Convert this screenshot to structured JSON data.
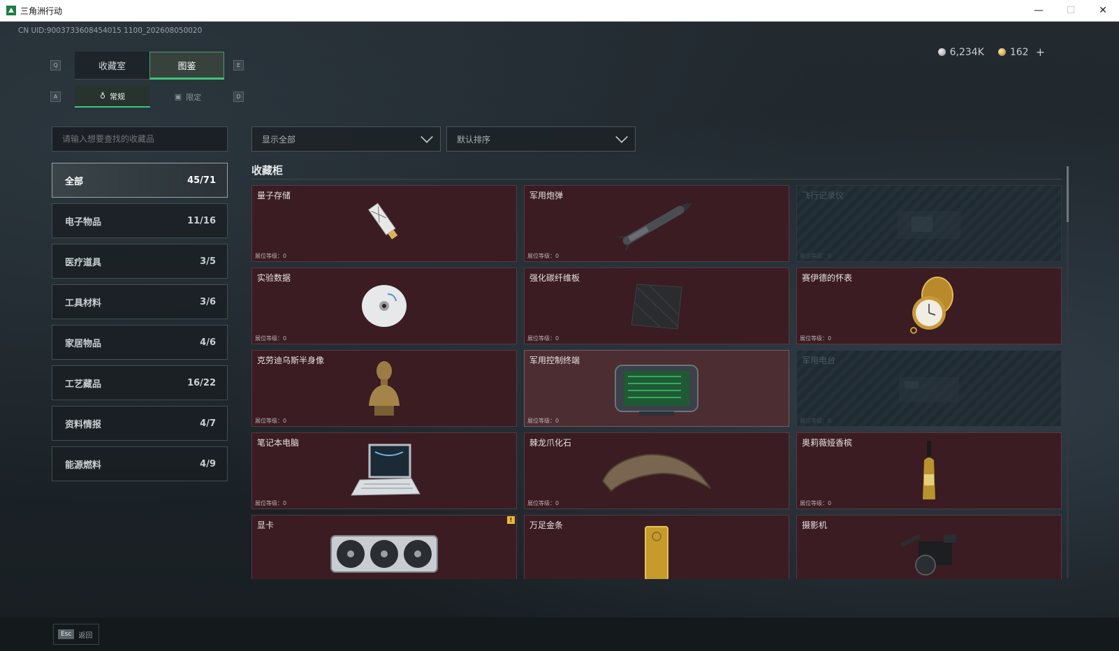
{
  "window": {
    "title": "三角洲行动",
    "min": "—",
    "max": "☐",
    "close": "✕"
  },
  "uid": "CN UID:9003733608454015 1100_202608050020",
  "currency": {
    "silver": "6,234K",
    "gold": "162",
    "plus": "+"
  },
  "keys": {
    "q": "Q",
    "e": "E",
    "a": "A",
    "d": "D"
  },
  "tabs": [
    {
      "label": "收藏室"
    },
    {
      "label": "图鉴"
    }
  ],
  "subtabs": [
    {
      "label": "常规"
    },
    {
      "label": "限定"
    }
  ],
  "search": {
    "placeholder": "请输入想要查找的收藏品"
  },
  "filter": {
    "label": "显示全部"
  },
  "sort": {
    "label": "默认排序"
  },
  "categories": [
    {
      "name": "全部",
      "count": "45/71"
    },
    {
      "name": "电子物品",
      "count": "11/16"
    },
    {
      "name": "医疗道具",
      "count": "3/5"
    },
    {
      "name": "工具材料",
      "count": "3/6"
    },
    {
      "name": "家居物品",
      "count": "4/6"
    },
    {
      "name": "工艺藏品",
      "count": "16/22"
    },
    {
      "name": "资料情报",
      "count": "4/7"
    },
    {
      "name": "能源燃料",
      "count": "4/9"
    }
  ],
  "section": {
    "title": "收藏柜"
  },
  "level_label": "展位等级：0",
  "items": [
    {
      "name": "量子存储",
      "icon": "usb-drive-icon"
    },
    {
      "name": "军用炮弹",
      "icon": "missile-icon"
    },
    {
      "name": "飞行记录仪",
      "icon": "flight-recorder-icon",
      "locked": true
    },
    {
      "name": "实验数据",
      "icon": "disc-icon"
    },
    {
      "name": "强化碳纤维板",
      "icon": "carbon-plate-icon"
    },
    {
      "name": "赛伊德的怀表",
      "icon": "pocket-watch-icon"
    },
    {
      "name": "克劳迪乌斯半身像",
      "icon": "bust-icon"
    },
    {
      "name": "军用控制终端",
      "icon": "control-terminal-icon",
      "selected": true
    },
    {
      "name": "军用电台",
      "icon": "radio-icon",
      "locked": true
    },
    {
      "name": "笔记本电脑",
      "icon": "laptop-icon"
    },
    {
      "name": "棘龙爪化石",
      "icon": "claw-fossil-icon"
    },
    {
      "name": "奥莉薇娅香槟",
      "icon": "champagne-icon"
    },
    {
      "name": "显卡",
      "icon": "graphics-card-icon",
      "new_badge": "!"
    },
    {
      "name": "万足金条",
      "icon": "gold-bar-icon"
    },
    {
      "name": "摄影机",
      "icon": "camera-icon"
    }
  ],
  "footer": {
    "esc_key": "Esc",
    "back_label": "返回"
  }
}
